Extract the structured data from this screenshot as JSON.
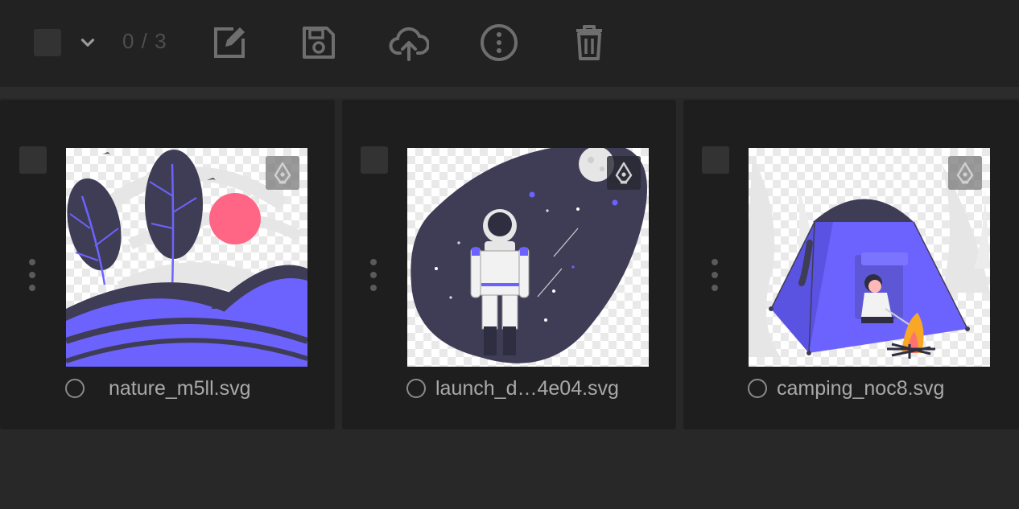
{
  "toolbar": {
    "selection_count": "0 / 3",
    "icons": [
      "select-all-checkbox",
      "chevron-down-icon",
      "edit-icon",
      "save-icon",
      "cloud-upload-icon",
      "more-info-icon",
      "trash-icon"
    ]
  },
  "files": [
    {
      "name": "nature_m5ll.svg",
      "type_badge": "pen-tool-icon"
    },
    {
      "name": "launch_d…4e04.svg",
      "type_badge": "pen-tool-icon"
    },
    {
      "name": "camping_noc8.svg",
      "type_badge": "pen-tool-icon"
    }
  ],
  "colors": {
    "background": "#282828",
    "toolbar": "#222222",
    "card": "#1e1e1e",
    "accent_purple": "#6c63ff",
    "dark_purple": "#3f3d56",
    "sun_pink": "#ff6584",
    "fire_orange": "#f9a826"
  }
}
